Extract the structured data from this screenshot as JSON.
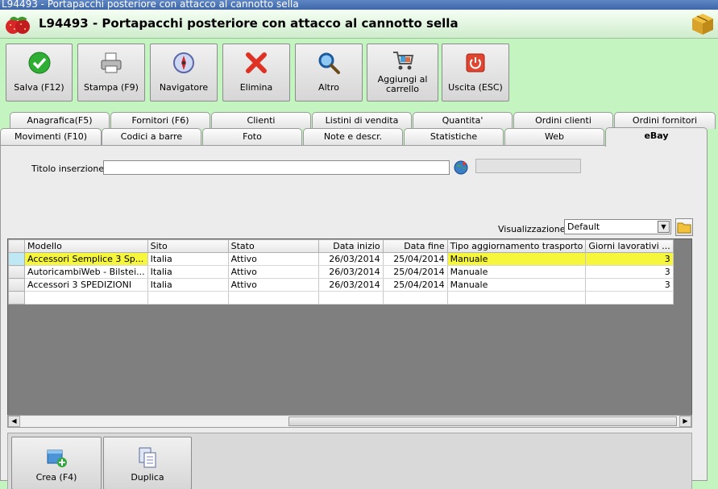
{
  "window": {
    "title": "L94493 - Portapacchi posteriore con attacco al cannotto sella"
  },
  "header": {
    "title": "L94493 - Portapacchi posteriore con attacco al cannotto sella"
  },
  "toolbar": {
    "salva": "Salva (F12)",
    "stampa": "Stampa (F9)",
    "navigatore": "Navigatore",
    "elimina": "Elimina",
    "altro": "Altro",
    "aggiungi": "Aggiungi al\ncarrello",
    "uscita": "Uscita (ESC)"
  },
  "tabs": {
    "row1": [
      "Anagrafica(F5)",
      "Fornitori (F6)",
      "Clienti",
      "Listini di vendita",
      "Quantita'",
      "Ordini clienti",
      "Ordini fornitori"
    ],
    "row2": [
      "Movimenti (F10)",
      "Codici a barre",
      "Foto",
      "Note e descr.",
      "Statistiche",
      "Web",
      "eBay"
    ]
  },
  "ebay": {
    "titolo_label": "Titolo inserzione :",
    "titolo_value": "",
    "visualizzazione_label": "Visualizzazione :",
    "visualizzazione_value": "Default"
  },
  "grid": {
    "columns": [
      "Modello",
      "Sito",
      "Stato",
      "Data inizio",
      "Data fine",
      "Tipo aggiornamento trasporto",
      "Giorni lavorativi ..."
    ],
    "rows": [
      [
        "Accessori Semplice 3 Sp...",
        "Italia",
        "Attivo",
        "26/03/2014",
        "25/04/2014",
        "Manuale",
        "3"
      ],
      [
        "AutoricambiWeb - Bilstei...",
        "Italia",
        "Attivo",
        "26/03/2014",
        "25/04/2014",
        "Manuale",
        "3"
      ],
      [
        "Accessori 3 SPEDIZIONI",
        "Italia",
        "Attivo",
        "26/03/2014",
        "25/04/2014",
        "Manuale",
        "3"
      ]
    ]
  },
  "actions": {
    "crea": "Crea (F4)",
    "duplica": "Duplica"
  },
  "colors": {
    "background": "#c4f5c0",
    "highlight": "#f6f63c",
    "titlebar": "#4a72b2"
  }
}
